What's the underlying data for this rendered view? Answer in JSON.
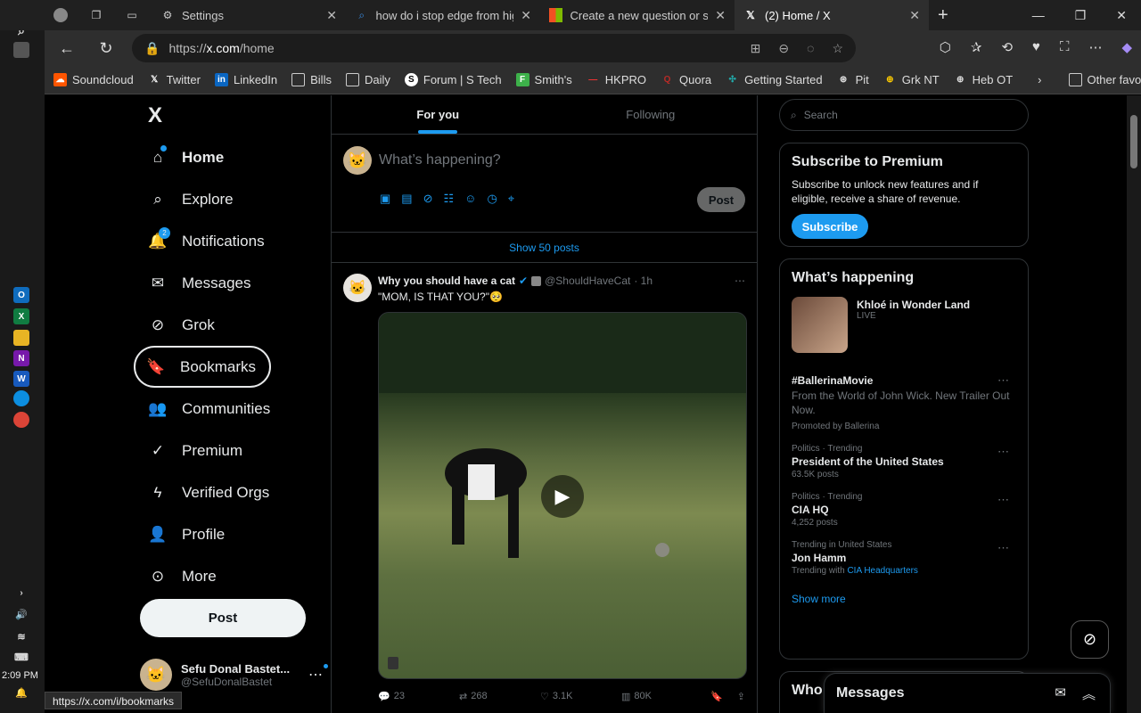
{
  "browser": {
    "tabs": [
      {
        "label": "Settings",
        "icon": "gear-icon"
      },
      {
        "label": "how do i stop edge from high",
        "icon": "search-icon"
      },
      {
        "label": "Create a new question or start",
        "icon": "microsoft-icon"
      },
      {
        "label": "(2) Home / X",
        "icon": "x-icon"
      }
    ],
    "url_prefix": "https://",
    "url_host": "x.com",
    "url_path": "/home",
    "bookmarks": [
      "Soundcloud",
      "Twitter",
      "LinkedIn",
      "Bills",
      "Daily",
      "Forum | S Tech",
      "Smith's",
      "HKPRO",
      "Quora",
      "Getting Started",
      "Pit",
      "Grk NT",
      "Heb OT"
    ],
    "other_favorites": "Other favorites"
  },
  "taskbar": {
    "time": "2:09 PM"
  },
  "nav": {
    "logo": "X",
    "items": [
      {
        "label": "Home"
      },
      {
        "label": "Explore"
      },
      {
        "label": "Notifications",
        "badge": "2"
      },
      {
        "label": "Messages"
      },
      {
        "label": "Grok"
      },
      {
        "label": "Bookmarks"
      },
      {
        "label": "Communities"
      },
      {
        "label": "Premium"
      },
      {
        "label": "Verified Orgs"
      },
      {
        "label": "Profile"
      },
      {
        "label": "More"
      }
    ],
    "post_label": "Post",
    "account_name": "Sefu Donal Bastet...",
    "account_handle": "@SefuDonalBastet"
  },
  "main": {
    "tabs": [
      "For you",
      "Following"
    ],
    "compose_placeholder": "What’s happening?",
    "compose_post": "Post",
    "show_posts": "Show 50 posts",
    "tweet": {
      "name": "Why you should have a cat",
      "handle": "@ShouldHaveCat",
      "time": "· 1h",
      "text": "\"MOM, IS THAT YOU?\"🥺",
      "replies": "23",
      "reposts": "268",
      "likes": "3.1K",
      "views": "80K"
    }
  },
  "side": {
    "search_placeholder": "Search",
    "premium_title": "Subscribe to Premium",
    "premium_text": "Subscribe to unlock new features and if eligible, receive a share of revenue.",
    "subscribe_label": "Subscribe",
    "happening_title": "What’s happening",
    "live": {
      "title": "Khloé in Wonder Land",
      "status": "LIVE"
    },
    "promo": {
      "title": "#BallerinaMovie",
      "text": "From the World of John Wick. New Trailer Out Now.",
      "promoted": "Promoted by Ballerina"
    },
    "trends": [
      {
        "meta": "Politics · Trending",
        "title": "President of the United States",
        "sub": "63.5K posts"
      },
      {
        "meta": "Politics · Trending",
        "title": "CIA HQ",
        "sub": "4,252 posts"
      },
      {
        "meta": "Trending in United States",
        "title": "Jon Hamm",
        "sub": "Trending with ",
        "link": "CIA Headquarters"
      }
    ],
    "show_more": "Show more",
    "who_title": "Who"
  },
  "messages_label": "Messages",
  "status_url": "https://x.com/i/bookmarks",
  "colors": {
    "accent": "#1d9bf0",
    "border": "#2f3336",
    "muted": "#71767b"
  }
}
